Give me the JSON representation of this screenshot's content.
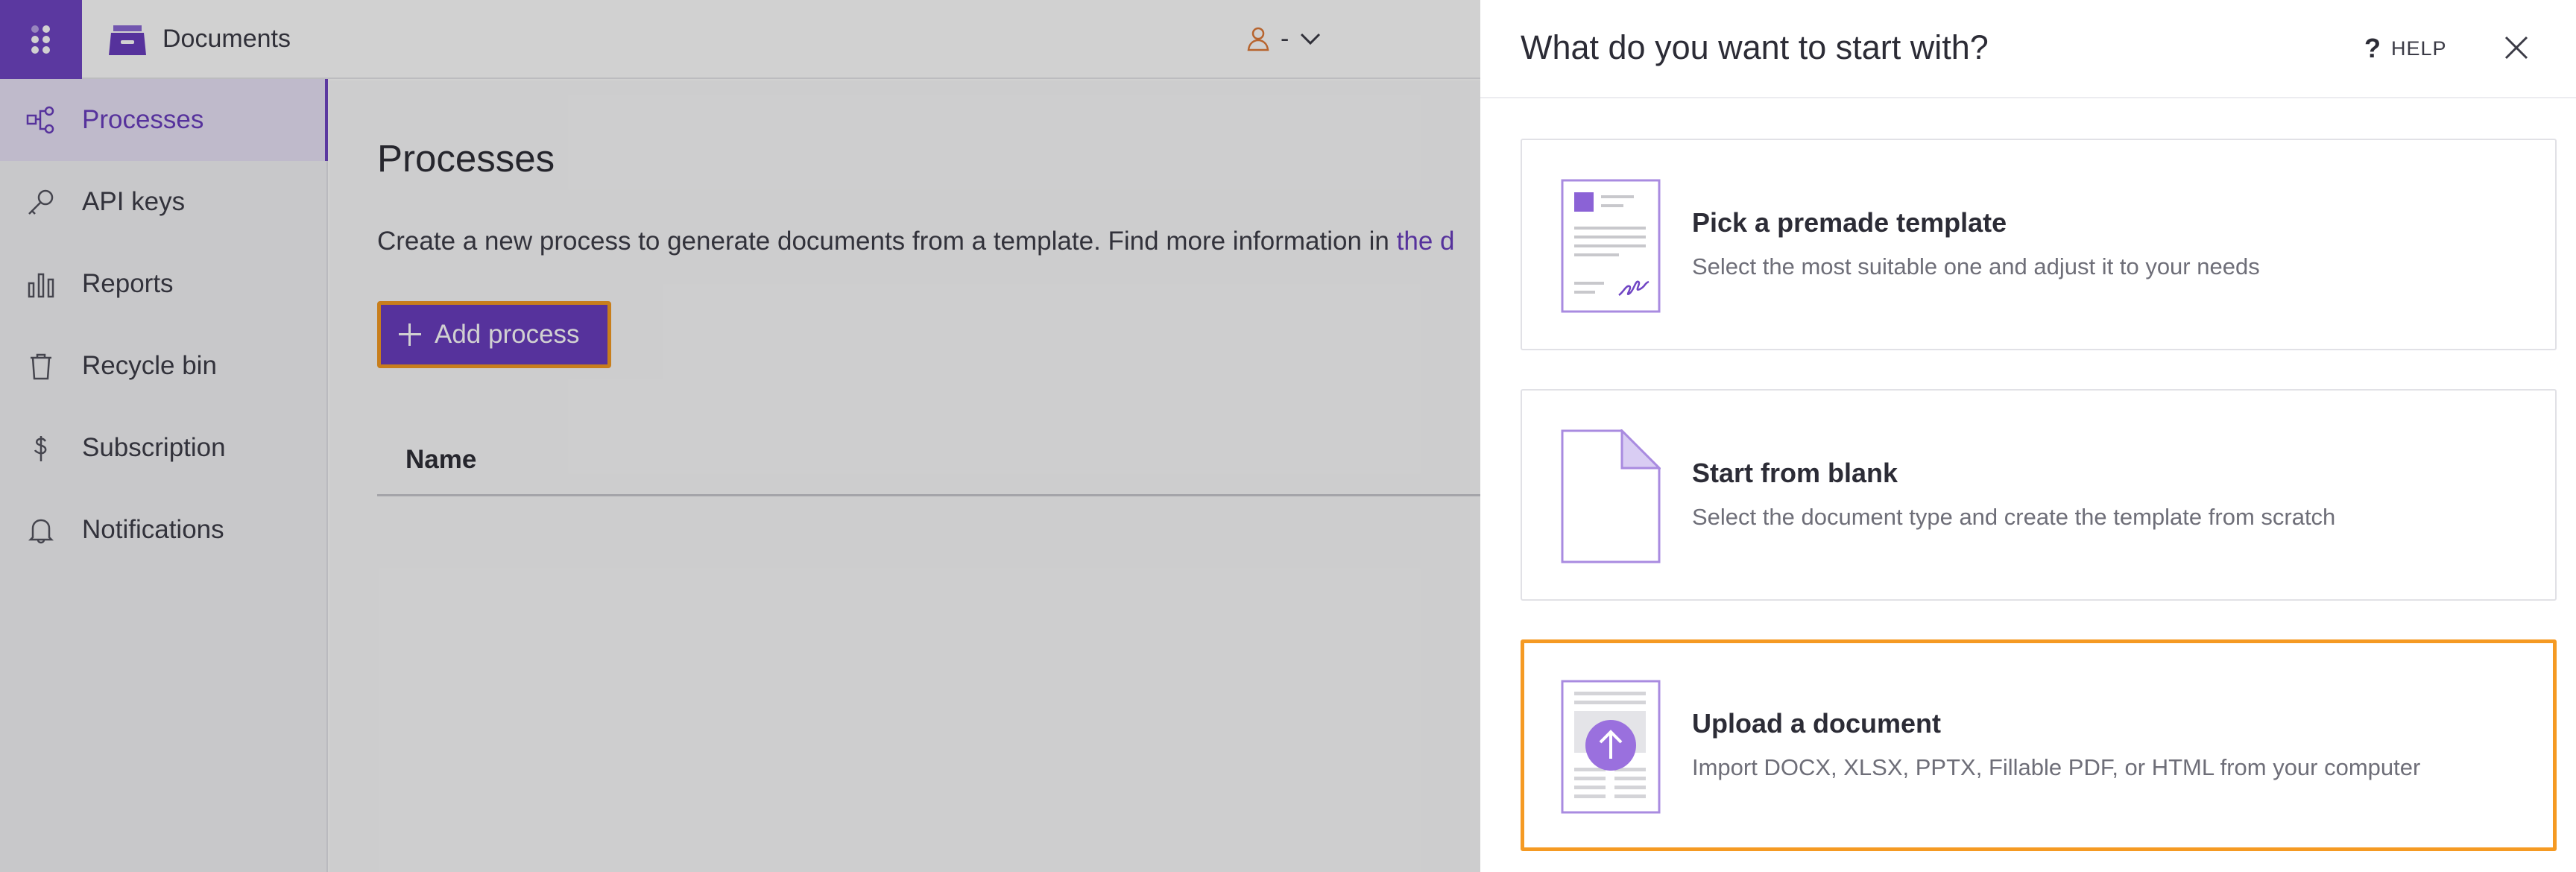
{
  "app": {
    "title": "Documents",
    "accent_color": "#6a3dbf",
    "highlight_color": "#f59a23",
    "apps_icon": "grid-icon",
    "logo_icon": "document-tray-icon"
  },
  "user_menu": {
    "icon": "user-icon",
    "label": "-",
    "caret_icon": "chevron-down-icon"
  },
  "sidebar": {
    "items": [
      {
        "label": "Processes",
        "icon": "processes-icon",
        "active": true
      },
      {
        "label": "API keys",
        "icon": "key-icon",
        "active": false
      },
      {
        "label": "Reports",
        "icon": "bar-chart-icon",
        "active": false
      },
      {
        "label": "Recycle bin",
        "icon": "trash-icon",
        "active": false
      },
      {
        "label": "Subscription",
        "icon": "dollar-icon",
        "active": false
      },
      {
        "label": "Notifications",
        "icon": "bell-icon",
        "active": false
      }
    ]
  },
  "main": {
    "title": "Processes",
    "description": "Create a new process to generate documents from a template. Find more information in",
    "description_link": "the d",
    "add_button": "Add process",
    "table": {
      "columns": [
        "Name"
      ]
    }
  },
  "drawer": {
    "title": "What do you want to start with?",
    "help_label": "HELP",
    "help_icon": "question-icon",
    "close_icon": "close-icon",
    "options": [
      {
        "title": "Pick a premade template",
        "description": "Select the most suitable one and adjust it to your needs",
        "icon": "template-document-icon",
        "highlighted": false
      },
      {
        "title": "Start from blank",
        "description": "Select the document type and create the template from scratch",
        "icon": "blank-page-icon",
        "highlighted": false
      },
      {
        "title": "Upload a document",
        "description": "Import DOCX, XLSX, PPTX, Fillable PDF, or HTML from your computer",
        "icon": "upload-document-icon",
        "highlighted": true
      }
    ]
  }
}
